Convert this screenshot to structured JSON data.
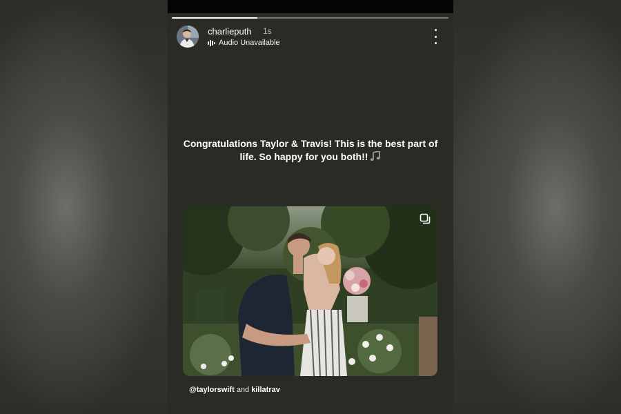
{
  "story": {
    "username": "charlieputh",
    "time_ago": "1s",
    "audio_status": "Audio Unavailable",
    "progress": 0.31,
    "caption": "Congratulations Taylor & Travis! This is the best part of life. So happy for you both!!",
    "caption_icon": "music-note-icon",
    "tag_one": "@taylorswift",
    "tag_conjunction": "and",
    "tag_two": "killatrav"
  },
  "icons": {
    "avatar": "avatar",
    "audio": "audio-bars-icon",
    "more": "more-vertical-icon",
    "multi_photo": "carousel-icon"
  },
  "colors": {
    "story_background": "#2b2b25",
    "text": "#ffffff",
    "muted_text": "#b9b9b2"
  }
}
